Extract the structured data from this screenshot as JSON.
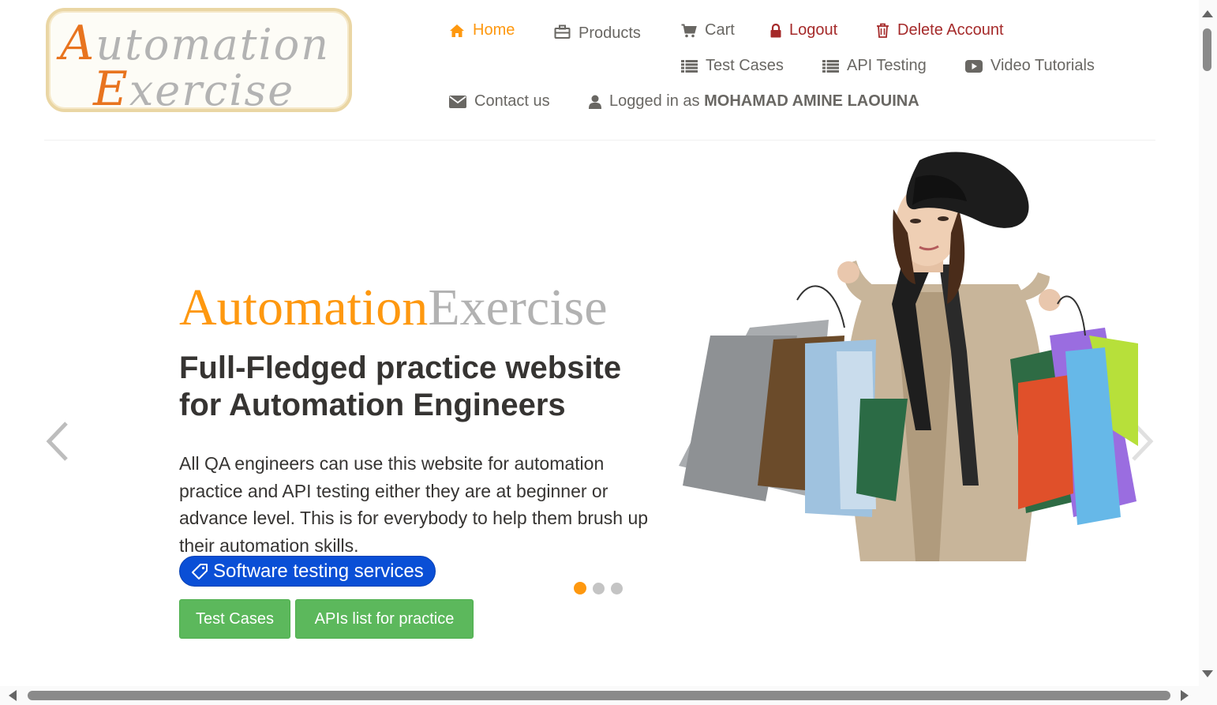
{
  "logo": {
    "line1_cap": "A",
    "line1_rest": "utomation",
    "line2_cap": "E",
    "line2_rest": "xercise"
  },
  "nav": {
    "home": "Home",
    "products": "Products",
    "cart": "Cart",
    "logout": "Logout",
    "delete_account": "Delete Account",
    "test_cases": "Test Cases",
    "api_testing": "API Testing",
    "video_tutorials": "Video Tutorials",
    "contact_us": "Contact us",
    "logged_in_prefix": "Logged in as",
    "username": "MOHAMAD AMINE LAOUINA"
  },
  "slider": {
    "brand_part1": "Automation",
    "brand_part2": "Exercise",
    "headline": "Full-Fledged practice website for Automation Engineers",
    "description": "All QA engineers can use this website for automation practice and API testing either they are at beginner or advance level. This is for everybody to help them brush up their automation skills.",
    "pill_label": "Software testing services",
    "btn_test_cases": "Test Cases",
    "btn_apis": "APIs list for practice",
    "active_slide": 1,
    "slide_count": 3
  },
  "colors": {
    "accent": "#fe980f",
    "danger": "#a52a2a",
    "success": "#5cb85c",
    "pill": "#0a4fd6"
  }
}
